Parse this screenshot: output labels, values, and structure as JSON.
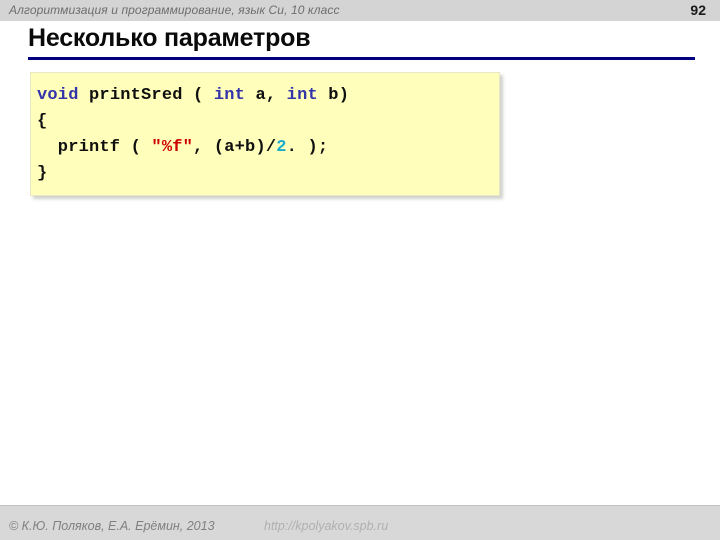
{
  "header": {
    "subject": "Алгоритмизация и программирование, язык Си, 10 класс",
    "page_number": "92",
    "band_color": "#d4d4d4"
  },
  "title": {
    "text": "Несколько параметров",
    "rule_color": "#000080"
  },
  "code": {
    "background": "#ffffbb",
    "keyword_color": "#3333aa",
    "string_color": "#cc0000",
    "number_color": "#19aacc",
    "lines": [
      {
        "tokens": [
          {
            "t": "void",
            "k": "kw"
          },
          {
            "t": " printSred ( ",
            "k": "plain"
          },
          {
            "t": "int",
            "k": "kw"
          },
          {
            "t": " a, ",
            "k": "plain"
          },
          {
            "t": "int",
            "k": "kw"
          },
          {
            "t": " b)",
            "k": "plain"
          }
        ]
      },
      {
        "tokens": [
          {
            "t": "{",
            "k": "plain"
          }
        ]
      },
      {
        "tokens": [
          {
            "t": "  printf ( ",
            "k": "plain"
          },
          {
            "t": "\"%f\"",
            "k": "str"
          },
          {
            "t": ", (a+b)/",
            "k": "plain"
          },
          {
            "t": "2",
            "k": "num"
          },
          {
            "t": ". );",
            "k": "plain"
          }
        ]
      },
      {
        "tokens": [
          {
            "t": "}",
            "k": "plain"
          }
        ]
      }
    ]
  },
  "footer": {
    "copyright": "© К.Ю. Поляков, Е.А. Ерёмин, 2013",
    "url": "http://kpolyakov.spb.ru"
  }
}
